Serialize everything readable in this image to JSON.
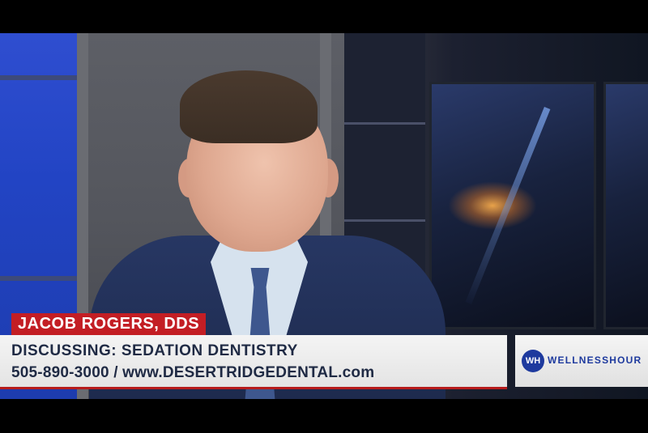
{
  "scene": {
    "description_colors": {
      "accent_red": "#c31e24",
      "bar_text": "#1f2a44",
      "brand_blue": "#1e3a9e"
    }
  },
  "lower_third": {
    "name": "JACOB ROGERS, DDS",
    "topic": "DISCUSSING: SEDATION DENTISTRY",
    "contact": "505-890-3000 / www.DESERTRIDGEDENTAL.com"
  },
  "logo": {
    "mark": "WH",
    "text": "WELLNESSHOUR"
  }
}
